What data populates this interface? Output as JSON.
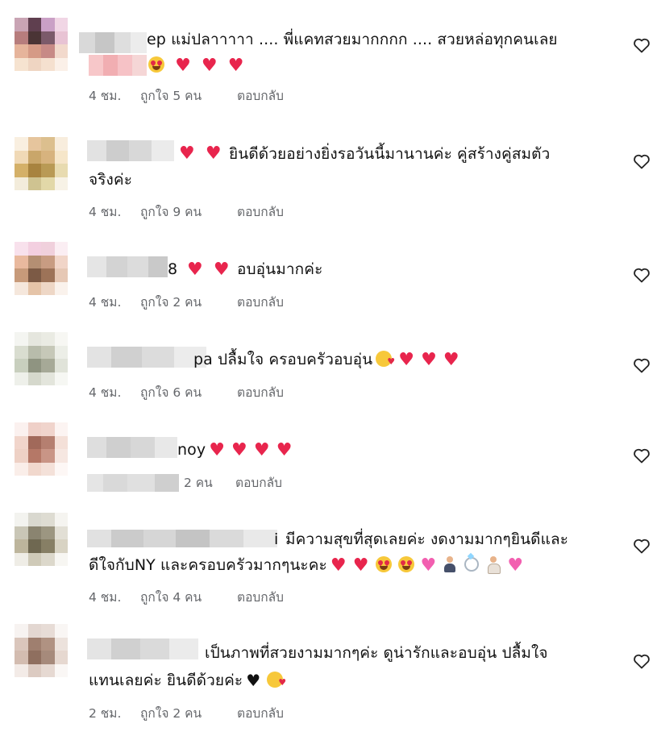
{
  "comments": [
    {
      "text_visible": "ep แม่ปลาาาาา .... พี่แคทสวยมากกกก .... สวยหล่อทุกคนเลย",
      "emojis": [
        "smiling-face-with-heart-eyes",
        "red-heart",
        "red-heart",
        "red-heart"
      ],
      "time": "4 ชม.",
      "likes": "ถูกใจ 5 คน",
      "reply": "ตอบกลับ"
    },
    {
      "text_visible": "ยินดีด้วยอย่างยิ่งรอวันนี้มานานค่ะ คู่สร้างคู่สมตัว",
      "text_line2": "จริงค่ะ",
      "emojis": [
        "red-heart",
        "red-heart"
      ],
      "time": "4 ชม.",
      "likes": "ถูกใจ 9 คน",
      "reply": "ตอบกลับ"
    },
    {
      "text_prefix": "8",
      "text_visible": "อบอุ่นมากค่ะ",
      "emojis": [
        "red-heart",
        "red-heart"
      ],
      "time": "4 ชม.",
      "likes": "ถูกใจ 2 คน",
      "reply": "ตอบกลับ"
    },
    {
      "text_visible": "pa ปลื้มใจ ครอบครัวอบอุ่น",
      "emojis": [
        "smiling-face-with-hearts",
        "red-heart",
        "red-heart",
        "red-heart"
      ],
      "time": "4 ชม.",
      "likes": "ถูกใจ 6 คน",
      "reply": "ตอบกลับ"
    },
    {
      "text_visible": "noy",
      "emojis": [
        "red-heart",
        "red-heart",
        "red-heart",
        "red-heart"
      ],
      "time": "",
      "likes": "2 คน",
      "reply": "ตอบกลับ"
    },
    {
      "text_prefix": "i",
      "text_visible": "มีความสุขที่สุดเลยค่ะ งดงามมากๆยินดีและ",
      "text_line2": "ดีใจกับNY และครอบครัวมากๆนะคะ",
      "emojis": [
        "red-heart",
        "red-heart",
        "smiling-face-with-heart-eyes",
        "smiling-face-with-heart-eyes",
        "pink-heart",
        "groom",
        "ring",
        "bride",
        "pink-heart"
      ],
      "time": "4 ชม.",
      "likes": "ถูกใจ 4 คน",
      "reply": "ตอบกลับ"
    },
    {
      "text_visible": "เป็นภาพที่สวยงามมากๆค่ะ ดูน่ารักและอบอุ่น ปลื้มใจ",
      "text_line2": "แทนเลยค่ะ ยินดีด้วยค่ะ",
      "emojis": [
        "black-heart",
        "smiling-face-with-hearts"
      ],
      "time": "2 ชม.",
      "likes": "ถูกใจ 2 คน",
      "reply": "ตอบกลับ"
    }
  ],
  "icons": {
    "like": "heart-outline-icon"
  }
}
